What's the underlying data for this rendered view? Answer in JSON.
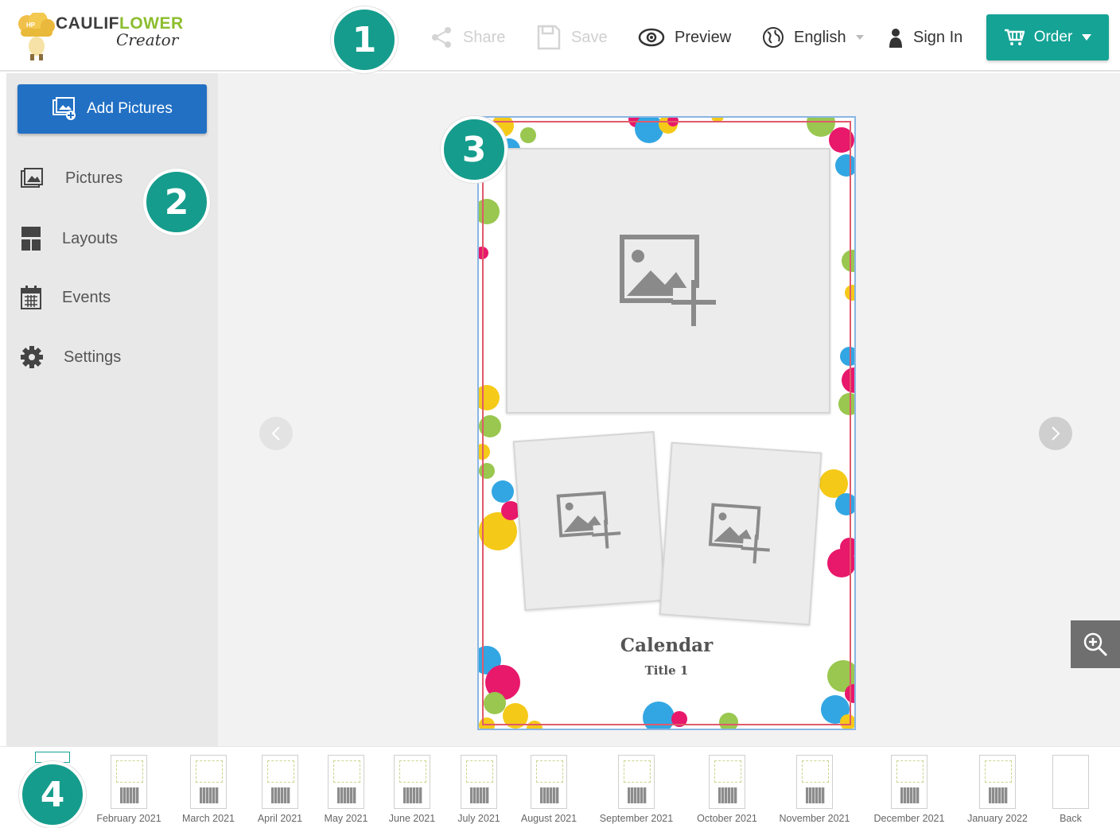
{
  "header": {
    "logo": {
      "brand_a": "CAULIF",
      "brand_b": "LOWER",
      "sub": "Creator"
    },
    "share_label": "Share",
    "save_label": "Save",
    "preview_label": "Preview",
    "language_label": "English",
    "signin_label": "Sign In",
    "order_label": "Order"
  },
  "sidebar": {
    "add_pictures_label": "Add Pictures",
    "items": [
      {
        "label": "Pictures",
        "icon": "pictures-icon"
      },
      {
        "label": "Layouts",
        "icon": "layouts-icon"
      },
      {
        "label": "Events",
        "icon": "calendar-icon"
      },
      {
        "label": "Settings",
        "icon": "gear-icon"
      }
    ]
  },
  "canvas": {
    "title": "Calendar",
    "subtitle": "Title 1"
  },
  "callouts": [
    "1",
    "2",
    "3",
    "4"
  ],
  "filmstrip": {
    "pages": [
      "February 2021",
      "March 2021",
      "April 2021",
      "May 2021",
      "June 2021",
      "July 2021",
      "August 2021",
      "September 2021",
      "October 2021",
      "November 2021",
      "December 2021",
      "January 2022",
      "Back"
    ]
  },
  "colors": {
    "accent": "#14a395",
    "primary": "#2270c4",
    "callout": "#159c8c"
  }
}
